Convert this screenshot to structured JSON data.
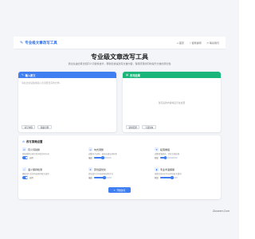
{
  "brand": {
    "name": "专业级文章改写工具"
  },
  "nav": [
    "首页",
    "使用说明",
    "联系我们"
  ],
  "hero": {
    "title": "专业级文章改写工具",
    "subtitle": "通过先进的算法和同义词替换技术，帮助您快速改写文章内容，保持原意的同时提升文章的原创性"
  },
  "input_panel": {
    "header": "输入原文",
    "placeholder": "请在此处粘贴或输入您需要改写的文章...",
    "buttons": [
      "清空内容",
      "粘贴示例"
    ]
  },
  "output_panel": {
    "header": "改写结果",
    "empty_hint": "改写后的内容将显示在这里",
    "buttons": [
      "复制结果",
      "下载文本"
    ]
  },
  "settings": {
    "title": "改写策略设置",
    "options": [
      {
        "name": "同义词替换",
        "desc": "智能替换文章中的词语为同义词",
        "control": "toggle",
        "value": "启用"
      },
      {
        "name": "句式调整",
        "desc": "调整句子结构，使表达更加多样化",
        "control": "slider",
        "label": "强度",
        "level": 0.5
      },
      {
        "name": "段落重组",
        "desc": "调整段落顺序，优化文章结构",
        "control": "slider",
        "label": "程度",
        "level": 0.3
      },
      {
        "name": "语义保持检测",
        "desc": "确保改写后的内容保持原文意思",
        "control": "toggle",
        "value": "启用"
      },
      {
        "name": "原创度优化",
        "desc": "提高改写后内容的原创性评分",
        "control": "slider",
        "label": "强度",
        "level": 0.6
      },
      {
        "name": "专业术语保留",
        "desc": "保留文章中的专业术语和关键词",
        "control": "slider",
        "label": "程度",
        "level": 0.7
      }
    ]
  },
  "primary_action": "开始改写",
  "watermark": "Zuowen.Com"
}
